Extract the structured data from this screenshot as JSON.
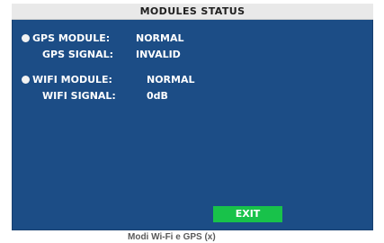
{
  "screen": {
    "title": "MODULES STATUS",
    "gps": {
      "module_label": "GPS MODULE:",
      "module_value": "NORMAL",
      "signal_label": "GPS SIGNAL:",
      "signal_value": "INVALID"
    },
    "wifi": {
      "module_label": "WIFI MODULE:",
      "module_value": "NORMAL",
      "signal_label": "WIFI SIGNAL:",
      "signal_value": "0dB"
    },
    "exit_label": "EXIT"
  },
  "caption": "Modi Wi-Fi e GPS (x)",
  "colors": {
    "background": "#1c4d86",
    "title_bar": "#e9e9e9",
    "exit_button": "#18c24a",
    "text": "#ffffff"
  },
  "icons": {
    "bullet": "status-dot-icon"
  }
}
